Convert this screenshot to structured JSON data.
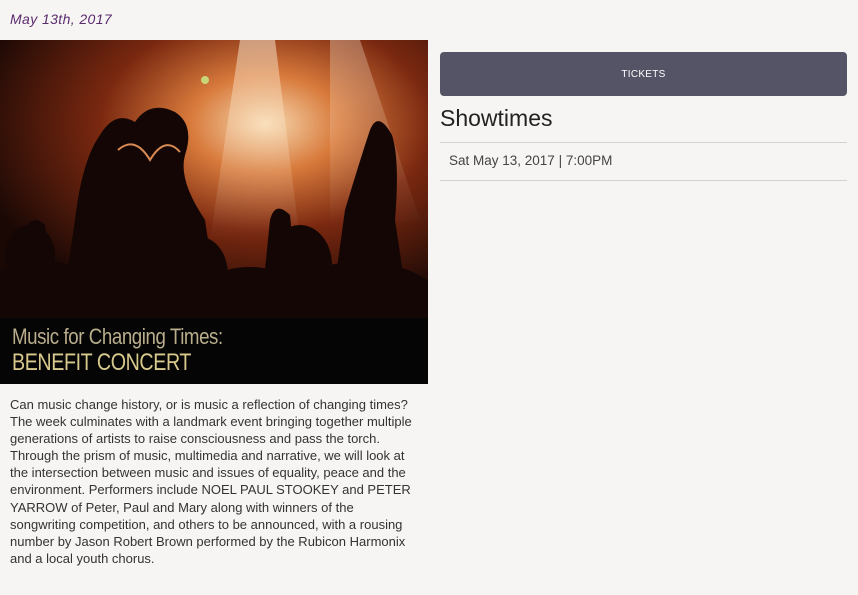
{
  "event": {
    "date": "May 13th, 2017",
    "banner_line1": "Music for Changing Times:",
    "banner_line2": "BENEFIT CONCERT",
    "description": "Can music change history, or is music a reflection of changing times? The week culminates with a landmark event bringing together multiple generations of artists to raise consciousness and pass the torch. Through the prism of music, multimedia and narrative, we will look at the intersection between music and issues of equality, peace and the environment. Performers include NOEL PAUL STOOKEY and PETER YARROW of Peter, Paul and Mary along with winners of the songwriting competition, and others to be announced, with a rousing number by Jason Robert Brown performed by the Rubicon Harmonix and a local youth chorus."
  },
  "tickets": {
    "label": "TICKETS"
  },
  "showtimes": {
    "title": "Showtimes",
    "items": [
      {
        "label": "Sat May 13, 2017 | 7:00PM"
      }
    ]
  },
  "colors": {
    "background": "#f6f5f3",
    "date_text": "#5a2a6e",
    "tickets_button": "#555366",
    "banner_gold": "#d8c98c"
  }
}
